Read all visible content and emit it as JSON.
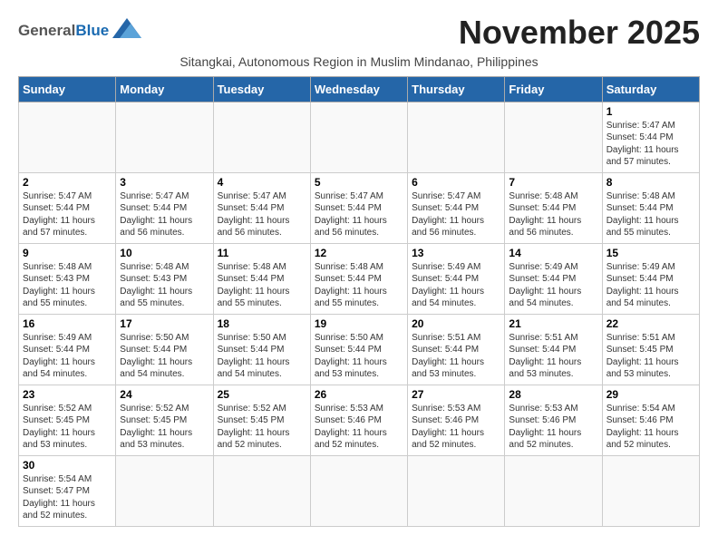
{
  "header": {
    "logo_general": "General",
    "logo_blue": "Blue",
    "month_title": "November 2025",
    "subtitle": "Sitangkai, Autonomous Region in Muslim Mindanao, Philippines"
  },
  "days_of_week": [
    "Sunday",
    "Monday",
    "Tuesday",
    "Wednesday",
    "Thursday",
    "Friday",
    "Saturday"
  ],
  "weeks": [
    [
      {
        "day": "",
        "info": ""
      },
      {
        "day": "",
        "info": ""
      },
      {
        "day": "",
        "info": ""
      },
      {
        "day": "",
        "info": ""
      },
      {
        "day": "",
        "info": ""
      },
      {
        "day": "",
        "info": ""
      },
      {
        "day": "1",
        "info": "Sunrise: 5:47 AM\nSunset: 5:44 PM\nDaylight: 11 hours\nand 57 minutes."
      }
    ],
    [
      {
        "day": "2",
        "info": "Sunrise: 5:47 AM\nSunset: 5:44 PM\nDaylight: 11 hours\nand 57 minutes."
      },
      {
        "day": "3",
        "info": "Sunrise: 5:47 AM\nSunset: 5:44 PM\nDaylight: 11 hours\nand 56 minutes."
      },
      {
        "day": "4",
        "info": "Sunrise: 5:47 AM\nSunset: 5:44 PM\nDaylight: 11 hours\nand 56 minutes."
      },
      {
        "day": "5",
        "info": "Sunrise: 5:47 AM\nSunset: 5:44 PM\nDaylight: 11 hours\nand 56 minutes."
      },
      {
        "day": "6",
        "info": "Sunrise: 5:47 AM\nSunset: 5:44 PM\nDaylight: 11 hours\nand 56 minutes."
      },
      {
        "day": "7",
        "info": "Sunrise: 5:48 AM\nSunset: 5:44 PM\nDaylight: 11 hours\nand 56 minutes."
      },
      {
        "day": "8",
        "info": "Sunrise: 5:48 AM\nSunset: 5:44 PM\nDaylight: 11 hours\nand 55 minutes."
      }
    ],
    [
      {
        "day": "9",
        "info": "Sunrise: 5:48 AM\nSunset: 5:43 PM\nDaylight: 11 hours\nand 55 minutes."
      },
      {
        "day": "10",
        "info": "Sunrise: 5:48 AM\nSunset: 5:43 PM\nDaylight: 11 hours\nand 55 minutes."
      },
      {
        "day": "11",
        "info": "Sunrise: 5:48 AM\nSunset: 5:44 PM\nDaylight: 11 hours\nand 55 minutes."
      },
      {
        "day": "12",
        "info": "Sunrise: 5:48 AM\nSunset: 5:44 PM\nDaylight: 11 hours\nand 55 minutes."
      },
      {
        "day": "13",
        "info": "Sunrise: 5:49 AM\nSunset: 5:44 PM\nDaylight: 11 hours\nand 54 minutes."
      },
      {
        "day": "14",
        "info": "Sunrise: 5:49 AM\nSunset: 5:44 PM\nDaylight: 11 hours\nand 54 minutes."
      },
      {
        "day": "15",
        "info": "Sunrise: 5:49 AM\nSunset: 5:44 PM\nDaylight: 11 hours\nand 54 minutes."
      }
    ],
    [
      {
        "day": "16",
        "info": "Sunrise: 5:49 AM\nSunset: 5:44 PM\nDaylight: 11 hours\nand 54 minutes."
      },
      {
        "day": "17",
        "info": "Sunrise: 5:50 AM\nSunset: 5:44 PM\nDaylight: 11 hours\nand 54 minutes."
      },
      {
        "day": "18",
        "info": "Sunrise: 5:50 AM\nSunset: 5:44 PM\nDaylight: 11 hours\nand 54 minutes."
      },
      {
        "day": "19",
        "info": "Sunrise: 5:50 AM\nSunset: 5:44 PM\nDaylight: 11 hours\nand 53 minutes."
      },
      {
        "day": "20",
        "info": "Sunrise: 5:51 AM\nSunset: 5:44 PM\nDaylight: 11 hours\nand 53 minutes."
      },
      {
        "day": "21",
        "info": "Sunrise: 5:51 AM\nSunset: 5:44 PM\nDaylight: 11 hours\nand 53 minutes."
      },
      {
        "day": "22",
        "info": "Sunrise: 5:51 AM\nSunset: 5:45 PM\nDaylight: 11 hours\nand 53 minutes."
      }
    ],
    [
      {
        "day": "23",
        "info": "Sunrise: 5:52 AM\nSunset: 5:45 PM\nDaylight: 11 hours\nand 53 minutes."
      },
      {
        "day": "24",
        "info": "Sunrise: 5:52 AM\nSunset: 5:45 PM\nDaylight: 11 hours\nand 53 minutes."
      },
      {
        "day": "25",
        "info": "Sunrise: 5:52 AM\nSunset: 5:45 PM\nDaylight: 11 hours\nand 52 minutes."
      },
      {
        "day": "26",
        "info": "Sunrise: 5:53 AM\nSunset: 5:46 PM\nDaylight: 11 hours\nand 52 minutes."
      },
      {
        "day": "27",
        "info": "Sunrise: 5:53 AM\nSunset: 5:46 PM\nDaylight: 11 hours\nand 52 minutes."
      },
      {
        "day": "28",
        "info": "Sunrise: 5:53 AM\nSunset: 5:46 PM\nDaylight: 11 hours\nand 52 minutes."
      },
      {
        "day": "29",
        "info": "Sunrise: 5:54 AM\nSunset: 5:46 PM\nDaylight: 11 hours\nand 52 minutes."
      }
    ],
    [
      {
        "day": "30",
        "info": "Sunrise: 5:54 AM\nSunset: 5:47 PM\nDaylight: 11 hours\nand 52 minutes."
      },
      {
        "day": "",
        "info": ""
      },
      {
        "day": "",
        "info": ""
      },
      {
        "day": "",
        "info": ""
      },
      {
        "day": "",
        "info": ""
      },
      {
        "day": "",
        "info": ""
      },
      {
        "day": "",
        "info": ""
      }
    ]
  ]
}
